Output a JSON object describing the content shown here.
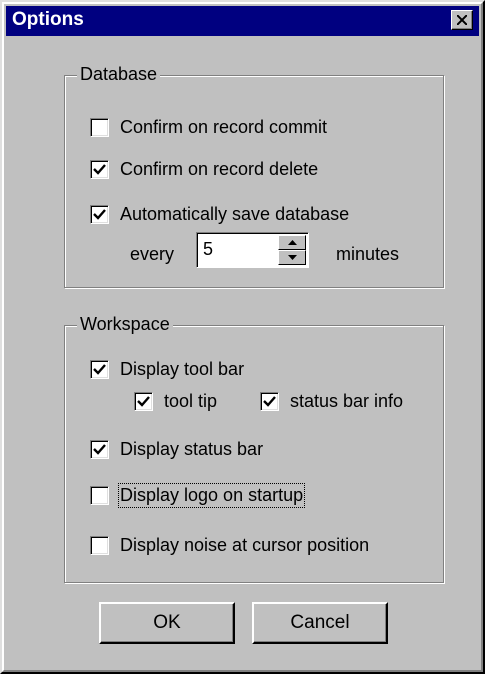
{
  "window": {
    "title": "Options"
  },
  "database": {
    "label": "Database",
    "confirm_commit": {
      "label": "Confirm on record commit",
      "checked": false
    },
    "confirm_delete": {
      "label": "Confirm on record delete",
      "checked": true
    },
    "autosave": {
      "label": "Automatically save database",
      "checked": true
    },
    "every_label": "every",
    "minutes_value": "5",
    "minutes_label": "minutes"
  },
  "workspace": {
    "label": "Workspace",
    "tool_bar": {
      "label": "Display tool bar",
      "checked": true
    },
    "tool_tip": {
      "label": "tool tip",
      "checked": true
    },
    "status_info": {
      "label": "status bar info",
      "checked": true
    },
    "status_bar": {
      "label": "Display status bar",
      "checked": true
    },
    "logo": {
      "label": "Display logo on startup",
      "checked": false
    },
    "noise": {
      "label": "Display noise at cursor position",
      "checked": false
    }
  },
  "buttons": {
    "ok": "OK",
    "cancel": "Cancel"
  },
  "colors": {
    "title_bar": "#000080",
    "face": "#c0c0c0"
  },
  "icons": {
    "close": "close-icon",
    "check": "checkmark-icon",
    "spin_up": "arrow-up-icon",
    "spin_down": "arrow-down-icon"
  }
}
